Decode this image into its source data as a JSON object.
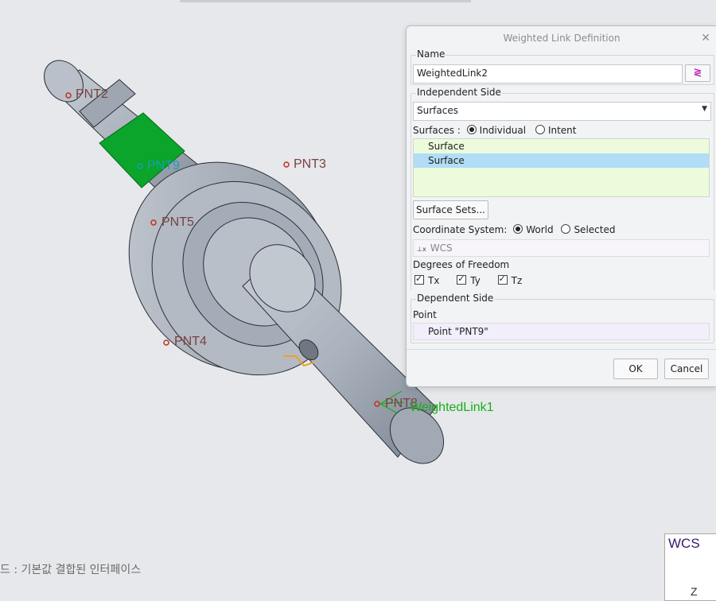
{
  "viewport": {
    "points": {
      "pnt2": "PNT2",
      "pnt9": "PNT9",
      "pnt3": "PNT3",
      "pnt5": "PNT5",
      "pnt4": "PNT4",
      "pnt8": "PNT8"
    },
    "link_label": "WeightedLink1",
    "status_text": "드 : 기본값 결합된 인터페이스",
    "wcs_label": "WCS",
    "axis_z": "Z"
  },
  "dialog": {
    "title": "Weighted Link Definition",
    "name_label": "Name",
    "name_value": "WeightedLink2",
    "independent_label": "Independent Side",
    "type_value": "Surfaces",
    "surfaces_prefix": "Surfaces :",
    "radio_individual": "Individual",
    "radio_intent": "Intent",
    "surface_items": [
      "Surface",
      "Surface"
    ],
    "surface_sets_button": "Surface Sets...",
    "coord_label": "Coordinate System:",
    "radio_world": "World",
    "radio_selected": "Selected",
    "csys_value": "WCS",
    "dof_label": "Degrees of Freedom",
    "tx": "Tx",
    "ty": "Ty",
    "tz": "Tz",
    "dependent_label": "Dependent Side",
    "point_label": "Point",
    "point_value": "Point \"PNT9\"",
    "ok": "OK",
    "cancel": "Cancel"
  },
  "colors": {
    "background": "#e6e8eb",
    "part_body": "#aeb6c1",
    "highlight_green": "#0aa52a",
    "selection_list": "#ecfbdc",
    "selected_row": "#b1ddf6"
  }
}
